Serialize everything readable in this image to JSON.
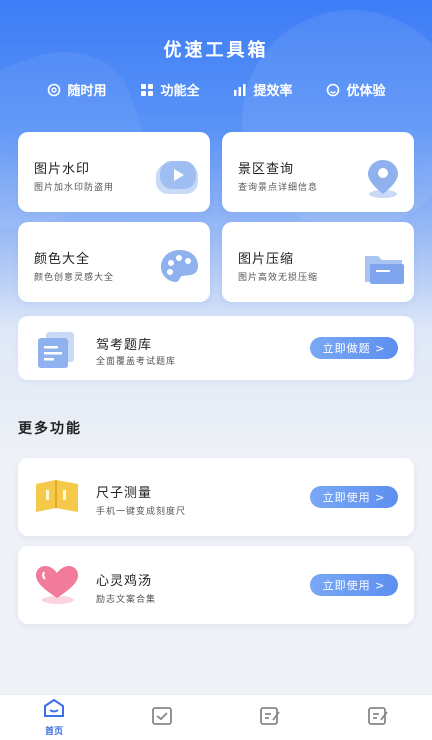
{
  "header": {
    "title": "优速工具箱"
  },
  "features": [
    {
      "icon": "at-icon",
      "label": "随时用"
    },
    {
      "icon": "grid-icon",
      "label": "功能全"
    },
    {
      "icon": "bar-chart-icon",
      "label": "提效率"
    },
    {
      "icon": "smile-icon",
      "label": "优体验"
    }
  ],
  "cards": {
    "watermark": {
      "title": "图片水印",
      "subtitle": "图片加水印防盗用"
    },
    "scenic": {
      "title": "景区查询",
      "subtitle": "查询景点详细信息"
    },
    "colors": {
      "title": "颜色大全",
      "subtitle": "颜色创意灵感大全"
    },
    "compress": {
      "title": "图片压缩",
      "subtitle": "图片高效无损压缩"
    },
    "exam": {
      "title": "驾考题库",
      "subtitle": "全面覆盖考试题库",
      "button": "立即做题 >"
    }
  },
  "more": {
    "title": "更多功能",
    "ruler": {
      "title": "尺子测量",
      "subtitle": "手机一键变成刻度尺",
      "button": "立即使用 >"
    },
    "soup": {
      "title": "心灵鸡汤",
      "subtitle": "励志文案合集",
      "button": "立即使用 >"
    }
  },
  "tabbar": {
    "home_label": "首页"
  },
  "colors": {
    "accent": "#3d7df6",
    "button": "#6c9cf2"
  }
}
